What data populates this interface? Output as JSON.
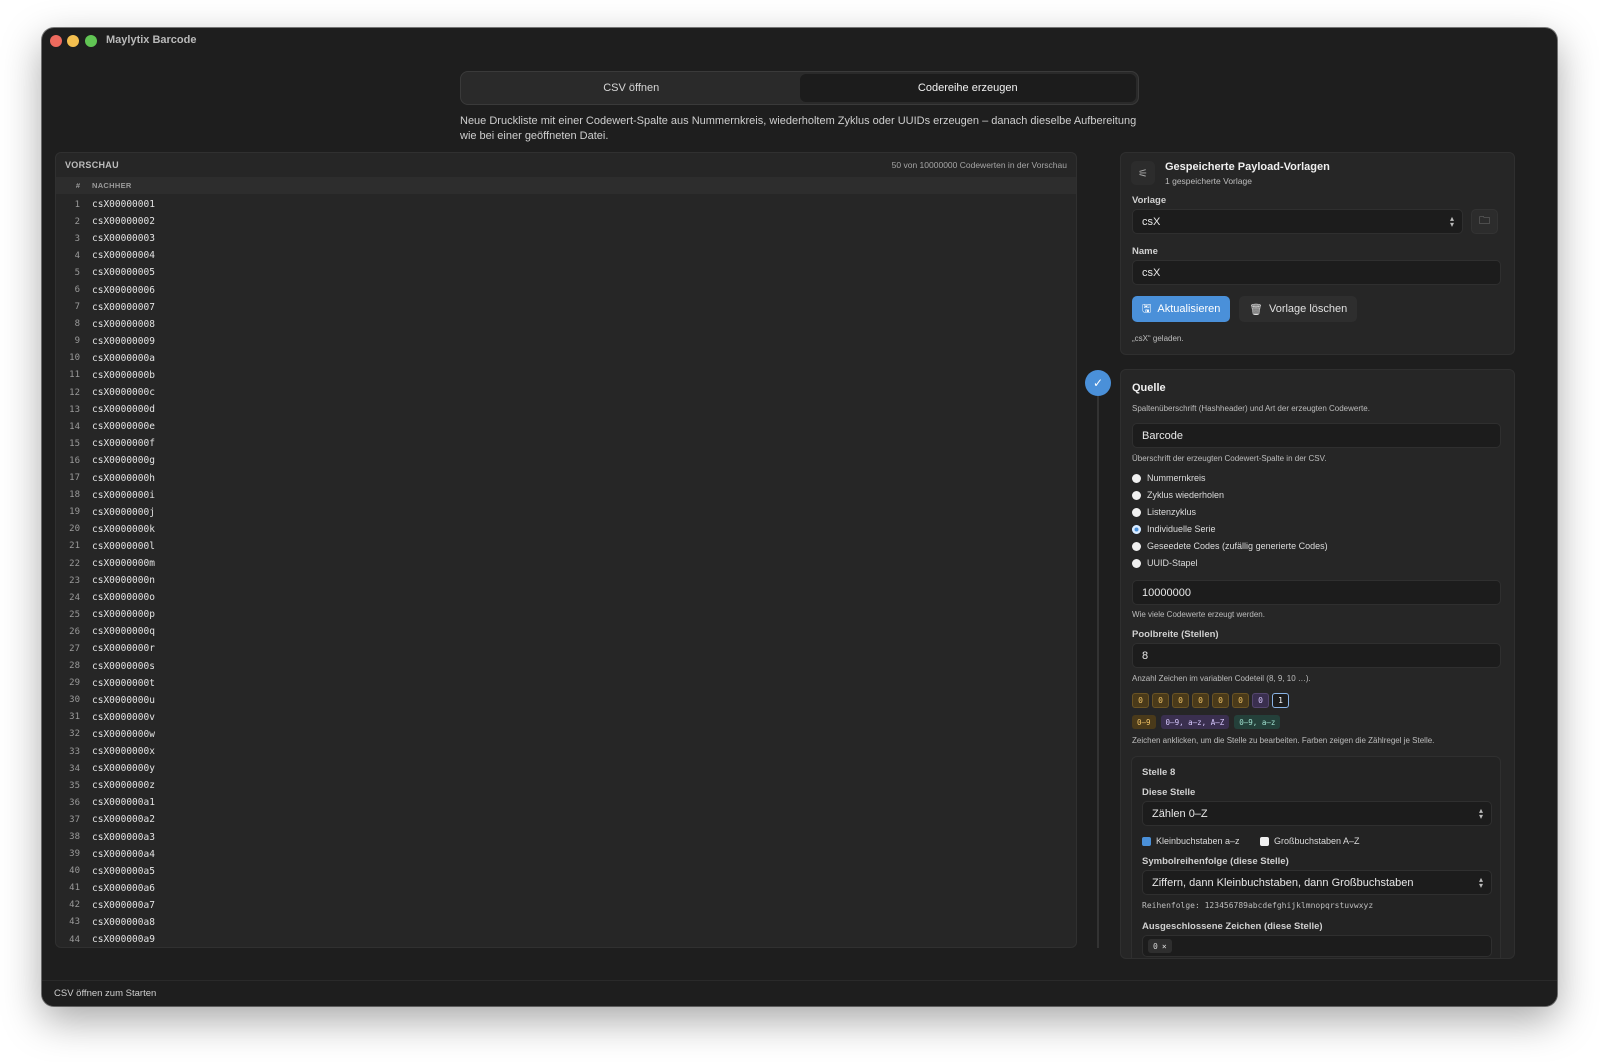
{
  "window": {
    "title": "Maylytix Barcode"
  },
  "tabs": [
    {
      "label": "CSV öffnen",
      "active": false
    },
    {
      "label": "Codereihe erzeugen",
      "active": true
    }
  ],
  "subtitle": "Neue Druckliste mit einer Codewert-Spalte aus Nummernkreis, wiederholtem Zyklus oder UUIDs erzeugen – danach dieselbe Aufbereitung wie bei einer geöffneten Datei.",
  "preview": {
    "title": "VORSCHAU",
    "count": "50 von 10000000 Codewerten in der Vorschau",
    "col_num": "#",
    "col_value": "NACHHER",
    "rows": [
      {
        "n": "1",
        "v": "csX00000001"
      },
      {
        "n": "2",
        "v": "csX00000002"
      },
      {
        "n": "3",
        "v": "csX00000003"
      },
      {
        "n": "4",
        "v": "csX00000004"
      },
      {
        "n": "5",
        "v": "csX00000005"
      },
      {
        "n": "6",
        "v": "csX00000006"
      },
      {
        "n": "7",
        "v": "csX00000007"
      },
      {
        "n": "8",
        "v": "csX00000008"
      },
      {
        "n": "9",
        "v": "csX00000009"
      },
      {
        "n": "10",
        "v": "csX0000000a"
      },
      {
        "n": "11",
        "v": "csX0000000b"
      },
      {
        "n": "12",
        "v": "csX0000000c"
      },
      {
        "n": "13",
        "v": "csX0000000d"
      },
      {
        "n": "14",
        "v": "csX0000000e"
      },
      {
        "n": "15",
        "v": "csX0000000f"
      },
      {
        "n": "16",
        "v": "csX0000000g"
      },
      {
        "n": "17",
        "v": "csX0000000h"
      },
      {
        "n": "18",
        "v": "csX0000000i"
      },
      {
        "n": "19",
        "v": "csX0000000j"
      },
      {
        "n": "20",
        "v": "csX0000000k"
      },
      {
        "n": "21",
        "v": "csX0000000l"
      },
      {
        "n": "22",
        "v": "csX0000000m"
      },
      {
        "n": "23",
        "v": "csX0000000n"
      },
      {
        "n": "24",
        "v": "csX0000000o"
      },
      {
        "n": "25",
        "v": "csX0000000p"
      },
      {
        "n": "26",
        "v": "csX0000000q"
      },
      {
        "n": "27",
        "v": "csX0000000r"
      },
      {
        "n": "28",
        "v": "csX0000000s"
      },
      {
        "n": "29",
        "v": "csX0000000t"
      },
      {
        "n": "30",
        "v": "csX0000000u"
      },
      {
        "n": "31",
        "v": "csX0000000v"
      },
      {
        "n": "32",
        "v": "csX0000000w"
      },
      {
        "n": "33",
        "v": "csX0000000x"
      },
      {
        "n": "34",
        "v": "csX0000000y"
      },
      {
        "n": "35",
        "v": "csX0000000z"
      },
      {
        "n": "36",
        "v": "csX000000a1"
      },
      {
        "n": "37",
        "v": "csX000000a2"
      },
      {
        "n": "38",
        "v": "csX000000a3"
      },
      {
        "n": "39",
        "v": "csX000000a4"
      },
      {
        "n": "40",
        "v": "csX000000a5"
      },
      {
        "n": "41",
        "v": "csX000000a6"
      },
      {
        "n": "42",
        "v": "csX000000a7"
      },
      {
        "n": "43",
        "v": "csX000000a8"
      },
      {
        "n": "44",
        "v": "csX000000a9"
      }
    ]
  },
  "templates": {
    "title": "Gespeicherte Payload-Vorlagen",
    "subtitle": "1 gespeicherte Vorlage",
    "template_label": "Vorlage",
    "template_value": "csX",
    "name_label": "Name",
    "name_value": "csX",
    "update_label": "Aktualisieren",
    "delete_label": "Vorlage löschen",
    "status": "„csX“ geladen."
  },
  "source": {
    "title": "Quelle",
    "description": "Spaltenüberschrift (Hashheader) und Art der erzeugten Codewerte.",
    "header_value": "Barcode",
    "header_hint": "Überschrift der erzeugten Codewert-Spalte in der CSV.",
    "options": [
      {
        "label": "Nummernkreis",
        "selected": false
      },
      {
        "label": "Zyklus wiederholen",
        "selected": false
      },
      {
        "label": "Listenzyklus",
        "selected": false
      },
      {
        "label": "Individuelle Serie",
        "selected": true
      },
      {
        "label": "Geseedete Codes (zufällig generierte Codes)",
        "selected": false
      },
      {
        "label": "UUID-Stapel",
        "selected": false
      }
    ],
    "count_value": "10000000",
    "count_hint": "Wie viele Codewerte erzeugt werden.",
    "pool_label": "Poolbreite (Stellen)",
    "pool_value": "8",
    "pool_hint": "Anzahl Zeichen im variablen Codeteil (8, 9, 10 …).",
    "chips": [
      "0",
      "0",
      "0",
      "0",
      "0",
      "0",
      "0",
      "1"
    ],
    "legend": [
      "0–9",
      "0–9, a–z, A–Z",
      "0–9, a–z"
    ],
    "chips_hint": "Zeichen anklicken, um die Stelle zu bearbeiten. Farben zeigen die Zählregel je Stelle.",
    "position": {
      "title": "Stelle 8",
      "this_label": "Diese Stelle",
      "this_value": "Zählen 0–Z",
      "lower_label": "Kleinbuchstaben a–z",
      "lower_checked": true,
      "upper_label": "Großbuchstaben A–Z",
      "upper_checked": false,
      "order_label": "Symbolreihenfolge (diese Stelle)",
      "order_value": "Ziffern, dann Kleinbuchstaben, dann Großbuchstaben",
      "order_preview": "Reihenfolge: 123456789abcdefghijklmnopqrstuvwxyz",
      "excluded_label": "Ausgeschlossene Zeichen (diese Stelle)",
      "excluded_token": "0"
    }
  },
  "status_bar": "CSV öffnen zum Starten",
  "colors": {
    "accent": "#4a90d9",
    "window_bg": "#1e1e1e",
    "panel_bg": "#262626"
  }
}
